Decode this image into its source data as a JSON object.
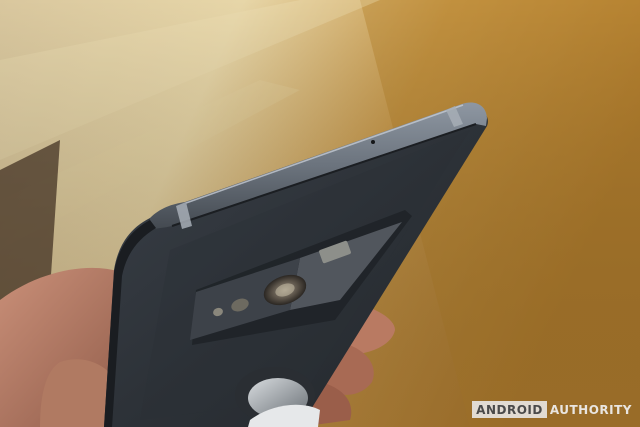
{
  "photo": {
    "subject": "smartphone-back"
  },
  "watermark": {
    "part1": "ANDROID",
    "part2": "AUTHORITY",
    "box_color": "#ebebeb",
    "text_color": "#f0f0f0"
  }
}
